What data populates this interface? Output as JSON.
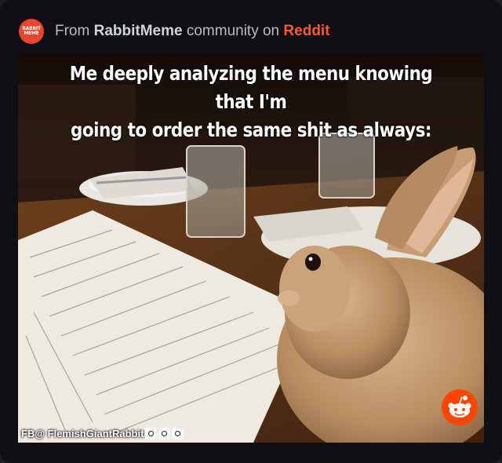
{
  "header": {
    "subreddit_icon": "rabbit-meme-logo-icon",
    "subreddit_icon_text": "RABBIT\nMEME",
    "prefix": "From",
    "community_name": "RabbitMeme",
    "middle": "community on",
    "site_name": "Reddit"
  },
  "meme": {
    "caption": "Me deeply analyzing the menu knowing that I'm\ngoing to order the same shit as always:",
    "watermark": "FB@ FlemishGiantRabbit",
    "social_icons": [
      "facebook-icon",
      "instagram-icon",
      "twitter-icon"
    ],
    "badge_icon": "reddit-snoo-icon"
  },
  "colors": {
    "background": "#0e1013",
    "accent": "#ff5a2c",
    "header_text": "#b8bcc4"
  }
}
